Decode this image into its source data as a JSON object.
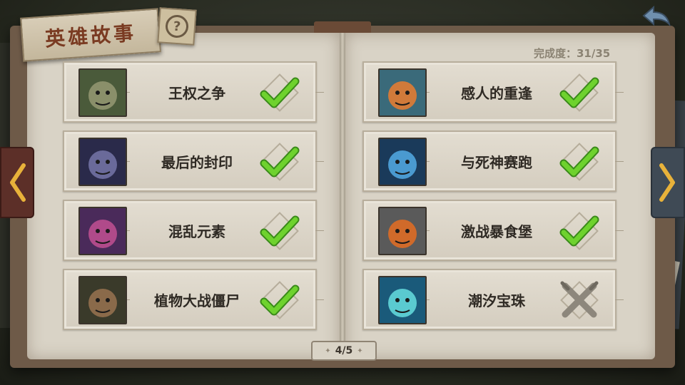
{
  "title": "英雄故事",
  "help_label": "?",
  "progress": "完成度：31/35",
  "page_indicator": "4/5",
  "stories_left": [
    {
      "title": "王权之争",
      "status": "complete",
      "portrait": "tree-king-portrait",
      "colors": [
        "#4a5a3a",
        "#8a8f6a"
      ]
    },
    {
      "title": "最后的封印",
      "status": "complete",
      "portrait": "dark-knight-portrait",
      "colors": [
        "#2a2a4a",
        "#6a6a9a"
      ]
    },
    {
      "title": "混乱元素",
      "status": "complete",
      "portrait": "chaos-mage-portrait",
      "colors": [
        "#4a2a5a",
        "#b04a8a"
      ]
    },
    {
      "title": "植物大战僵尸",
      "status": "complete",
      "portrait": "zombie-pirate-portrait",
      "colors": [
        "#3a3a2a",
        "#8a6a4a"
      ]
    }
  ],
  "stories_right": [
    {
      "title": "感人的重逢",
      "status": "complete",
      "portrait": "dwarf-portrait",
      "colors": [
        "#3a6a7a",
        "#d07a3a"
      ]
    },
    {
      "title": "与死神赛跑",
      "status": "complete",
      "portrait": "lightning-spirit-portrait",
      "colors": [
        "#1a3a5a",
        "#4a9ad0"
      ]
    },
    {
      "title": "激战暴食堡",
      "status": "complete",
      "portrait": "ogre-portrait",
      "colors": [
        "#5a5a5a",
        "#d06a2a"
      ]
    },
    {
      "title": "潮汐宝珠",
      "status": "locked",
      "portrait": "sea-serpent-portrait",
      "colors": [
        "#1a5a7a",
        "#5acad0"
      ]
    }
  ],
  "colors": {
    "check": "#6ed22e",
    "check_dark": "#3a8a1a",
    "locked": "#8d877c"
  }
}
